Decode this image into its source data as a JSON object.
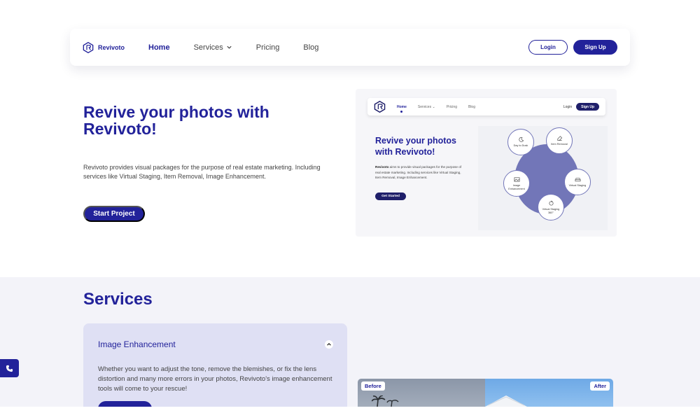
{
  "nav": {
    "logo_text": "Revivoto",
    "links": [
      {
        "label": "Home"
      },
      {
        "label": "Services"
      },
      {
        "label": "Pricing"
      },
      {
        "label": "Blog"
      }
    ],
    "login_label": "Login",
    "signup_label": "Sign Up"
  },
  "hero": {
    "title": "Revive your photos with Revivoto!",
    "description": "Revivoto provides visual packages for the purpose of real estate marketing. Including services like Virtual Staging, Item Removal, Image Enhancement.",
    "start_label": "Start Project"
  },
  "preview": {
    "nav_links": [
      "Home",
      "Services",
      "Pricing",
      "Blog"
    ],
    "login_label": "Login",
    "signup_label": "Sign Up",
    "title": "Revive your photos with Revivoto!",
    "desc_brand": "Revivoto",
    "desc_rest": " aims to provide visual packages for the purpose of real estate marketing. Including services like Virtual Staging, Item Removal, Image Enhancement.",
    "cta_label": "Get Started",
    "nodes": [
      {
        "label": "Day to Dusk",
        "icon": "moon-icon"
      },
      {
        "label": "Item Removal",
        "icon": "eraser-icon"
      },
      {
        "label": "Virtual Staging",
        "icon": "sofa-icon"
      },
      {
        "label": "Virtual Staging 360°",
        "icon": "rotate-icon"
      },
      {
        "label": "Image Enhancement",
        "icon": "image-icon"
      }
    ]
  },
  "services": {
    "title": "Services",
    "card": {
      "heading": "Image Enhancement",
      "description": "Whether you want to adjust the tone, remove the blemishes, or fix the lens distortion and many more errors in your photos, Revivoto's image enhancement tools will come to your rescue!"
    },
    "before_label": "Before",
    "after_label": "After"
  },
  "colors": {
    "brand": "#22229a",
    "accent_soft": "#7276b8",
    "section_bg": "#f3f3f9",
    "card_bg": "#dfe0f4"
  }
}
